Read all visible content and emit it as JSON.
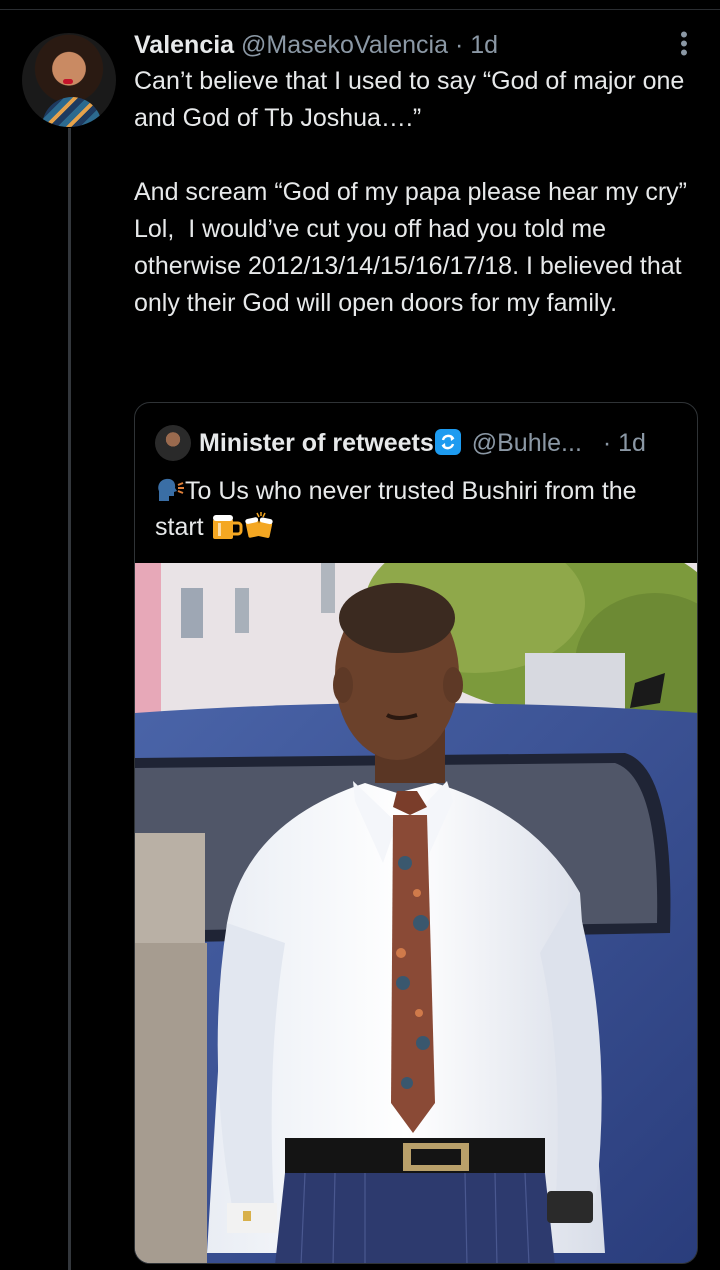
{
  "tweet": {
    "author_name": "Valencia",
    "author_handle": "@MasekoValencia",
    "separator": "·",
    "time": "1d",
    "text": "Can’t believe that I used to say “God of major one and God of Tb Joshua….”\n\nAnd scream “God of my papa please hear my cry”\nLol,  I would’ve cut you off had you told me otherwise 2012/13/14/15/16/17/18. I believed that only their God will open doors for my family."
  },
  "quote": {
    "author_name": "Minister of retweets",
    "author_handle": "@Buhle...",
    "separator": "·",
    "time": "1d",
    "text": "To Us who never trusted Bushiri from the start",
    "icons": [
      "speaking-head-emoji",
      "retweet-badge-icon",
      "beer-mugs-emoji"
    ]
  },
  "colors": {
    "background": "#000000",
    "text": "#e7e9ea",
    "secondary": "#8b98a5",
    "border": "#2f3336",
    "accent": "#1d9bf0"
  }
}
